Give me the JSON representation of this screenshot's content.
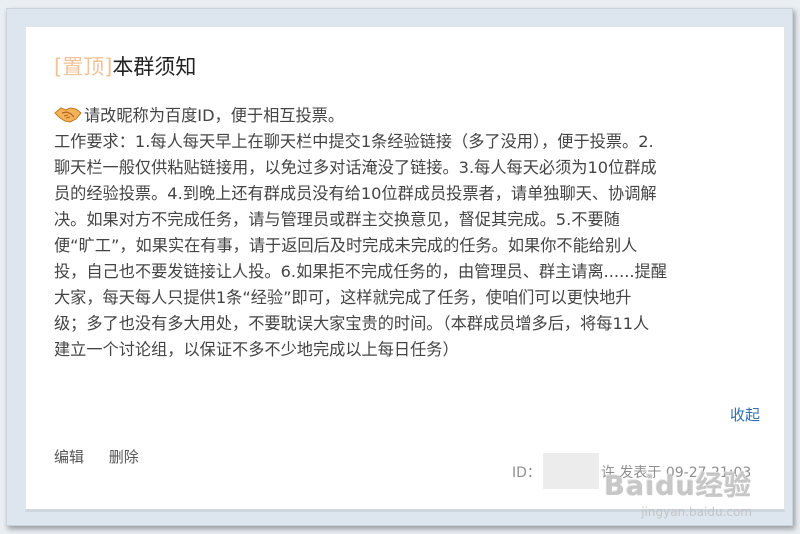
{
  "post": {
    "pin_tag": "[置顶]",
    "title": "本群须知",
    "icon": "handshake-icon",
    "lines": [
      "请改昵称为百度ID，便于相互投票。",
      "工作要求：1.每人每天早上在聊天栏中提交1条经验链接（多了没用），便于投票。2.",
      "聊天栏一般仅供粘贴链接用，以免过多对话淹没了链接。3.每人每天必须为10位群成",
      "员的经验投票。4.到晚上还有群成员没有给10位群成员投票者，请单独聊天、协调解",
      "决。如果对方不完成任务，请与管理员或群主交换意见，督促其完成。5.不要随",
      "便“旷工”，如果实在有事，请于返回后及时完成未完成的任务。如果你不能给别人",
      "投，自己也不要发链接让人投。6.如果拒不完成任务的，由管理员、群主请离......提醒",
      "大家，每天每人只提供1条“经验”即可，这样就完成了任务，使咱们可以更快地升",
      "级；多了也没有多大用处，不要耽误大家宝贵的时间。（本群成员增多后，将每11人",
      "建立一个讨论组，以保证不多不少地完成以上每日任务）"
    ],
    "collapse_label": "收起",
    "edit_label": "编辑",
    "delete_label": "删除",
    "meta_id_label": "ID：",
    "meta_author_tail": "许",
    "meta_posted": "发表于 09-27 21:03"
  },
  "watermark": {
    "logo": "Baidu经验",
    "url": "jingyan.baidu.com"
  },
  "colors": {
    "pin_tag": "#f0c49a",
    "link": "#2f6fb3",
    "meta": "#8f8f8f"
  }
}
